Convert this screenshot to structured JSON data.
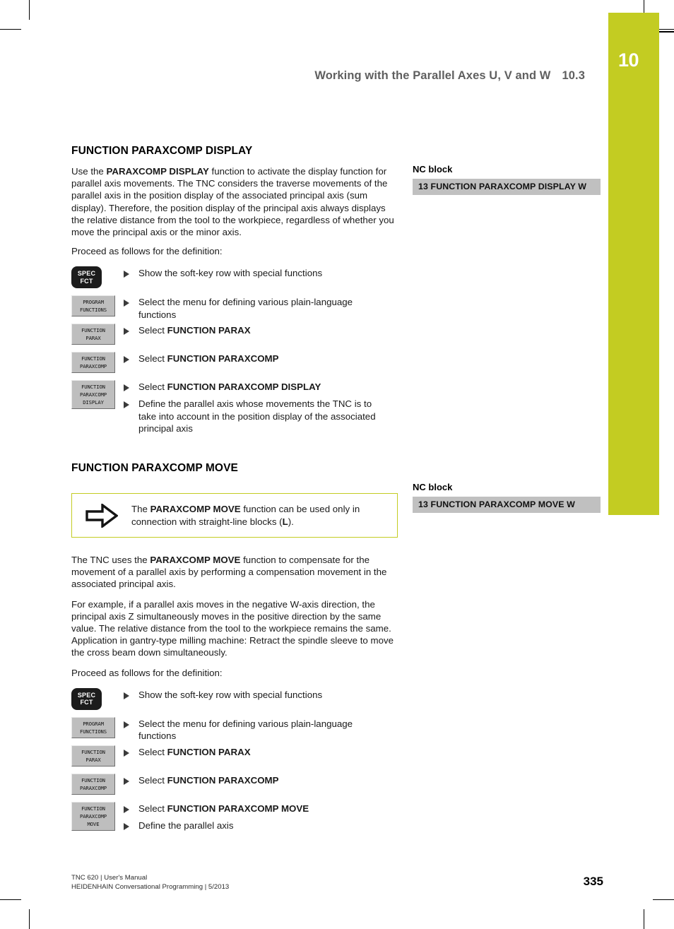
{
  "page": {
    "chapter_number": "10",
    "running_head_title": "Working with the Parallel Axes U, V and W",
    "running_head_section": "10.3",
    "page_number": "335",
    "accent_color": "#c3cc22",
    "nc_block_bg": "#c0c0c0"
  },
  "footer": {
    "line1": "TNC 620 | User's Manual",
    "line2": "HEIDENHAIN Conversational Programming | 5/2013"
  },
  "display_section": {
    "title": "FUNCTION PARAXCOMP DISPLAY",
    "intro_lead": "Use the ",
    "intro_bold": "PARAXCOMP DISPLAY",
    "intro_rest": " function to activate the display function for parallel axis movements. The TNC considers the traverse movements of the parallel axis in the position display of the associated principal axis (sum display). Therefore, the position display of the principal axis always displays the relative distance from the tool to the workpiece, regardless of whether you move the principal axis or the minor axis.",
    "proceed": "Proceed as follows for the definition:",
    "nc_label": "NC block",
    "nc_code": "13 FUNCTION PARAXCOMP DISPLAY W",
    "steps": [
      {
        "key_type": "hardware",
        "key_lines": [
          "SPEC",
          "FCT"
        ],
        "text": "Show the soft-key row with special functions",
        "text_bold": ""
      },
      {
        "key_type": "soft",
        "key_lines": [
          "PROGRAM",
          "FUNCTIONS"
        ],
        "text": "Select the menu for defining various plain-language functions",
        "text_bold": ""
      },
      {
        "key_type": "soft",
        "key_lines": [
          "FUNCTION",
          "PARAX"
        ],
        "text": "Select ",
        "text_bold": "FUNCTION PARAX"
      },
      {
        "key_type": "soft",
        "key_lines": [
          "FUNCTION",
          "PARAXCOMP"
        ],
        "text": "Select ",
        "text_bold": "FUNCTION PARAXCOMP"
      },
      {
        "key_type": "soft",
        "key_lines": [
          "FUNCTION",
          "PARAXCOMP",
          "DISPLAY"
        ],
        "text": "Select ",
        "text_bold": "FUNCTION PARAXCOMP DISPLAY"
      },
      {
        "key_type": "none",
        "key_lines": [],
        "text": "Define the parallel axis whose movements the TNC is to take into account in the position display of the associated principal axis",
        "text_bold": ""
      }
    ]
  },
  "move_section": {
    "title": "FUNCTION PARAXCOMP MOVE",
    "note_lead": "The ",
    "note_bold": "PARAXCOMP MOVE",
    "note_mid": " function can be used only in connection with straight-line blocks (",
    "note_bold2": "L",
    "note_end": ").",
    "note_icon": "arrow-right-outline-icon",
    "para1_lead": "The TNC uses the ",
    "para1_bold": "PARAXCOMP MOVE",
    "para1_rest": " function to compensate for the movement of a parallel axis by performing a compensation movement in the associated principal axis.",
    "para2": "For example, if a parallel axis moves in the negative W-axis direction, the principal axis Z simultaneously moves in the positive direction by the same value. The relative distance from the tool to the workpiece remains the same. Application in gantry-type milling machine: Retract the spindle sleeve to move the cross beam down simultaneously.",
    "proceed": "Proceed as follows for the definition:",
    "nc_label": "NC block",
    "nc_code": "13 FUNCTION PARAXCOMP MOVE W",
    "steps": [
      {
        "key_type": "hardware",
        "key_lines": [
          "SPEC",
          "FCT"
        ],
        "text": "Show the soft-key row with special functions",
        "text_bold": ""
      },
      {
        "key_type": "soft",
        "key_lines": [
          "PROGRAM",
          "FUNCTIONS"
        ],
        "text": "Select the menu for defining various plain-language functions",
        "text_bold": ""
      },
      {
        "key_type": "soft",
        "key_lines": [
          "FUNCTION",
          "PARAX"
        ],
        "text": "Select ",
        "text_bold": "FUNCTION PARAX"
      },
      {
        "key_type": "soft",
        "key_lines": [
          "FUNCTION",
          "PARAXCOMP"
        ],
        "text": "Select ",
        "text_bold": "FUNCTION PARAXCOMP"
      },
      {
        "key_type": "soft",
        "key_lines": [
          "FUNCTION",
          "PARAXCOMP",
          "MOVE"
        ],
        "text": "Select ",
        "text_bold": "FUNCTION PARAXCOMP MOVE"
      },
      {
        "key_type": "none",
        "key_lines": [],
        "text": "Define the parallel axis",
        "text_bold": ""
      }
    ]
  }
}
